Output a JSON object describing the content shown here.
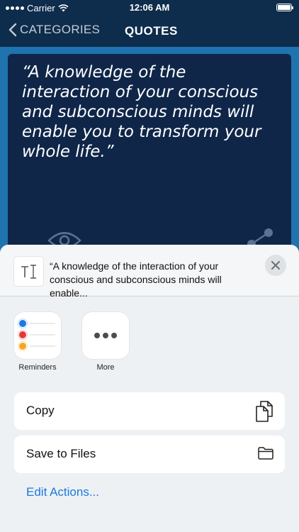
{
  "status_bar": {
    "carrier": "Carrier",
    "time": "12:06 AM"
  },
  "nav": {
    "back_label": "CATEGORIES",
    "title": "QUOTES"
  },
  "quote": {
    "text": "“A knowledge of the interaction of your conscious and subconscious minds will enable you to transform your whole life.”"
  },
  "share_sheet": {
    "preview_text": "“A knowledge of the interaction of your conscious and subconscious minds will enable...",
    "apps": [
      {
        "label": "Reminders",
        "icon": "reminders-icon"
      },
      {
        "label": "More",
        "icon": "more-icon"
      }
    ],
    "actions": [
      {
        "label": "Copy",
        "icon": "copy-icon"
      },
      {
        "label": "Save to Files",
        "icon": "folder-icon"
      }
    ],
    "edit_actions_label": "Edit Actions..."
  },
  "colors": {
    "nav_background": "#0e2c4c",
    "content_background": "#1f73ae",
    "card_background": "#0f2649",
    "sheet_background": "#eef1f3",
    "link_blue": "#1a7ae0",
    "reminder_blue": "#1a7ae0",
    "reminder_red": "#e53935",
    "reminder_orange": "#f5a623"
  }
}
